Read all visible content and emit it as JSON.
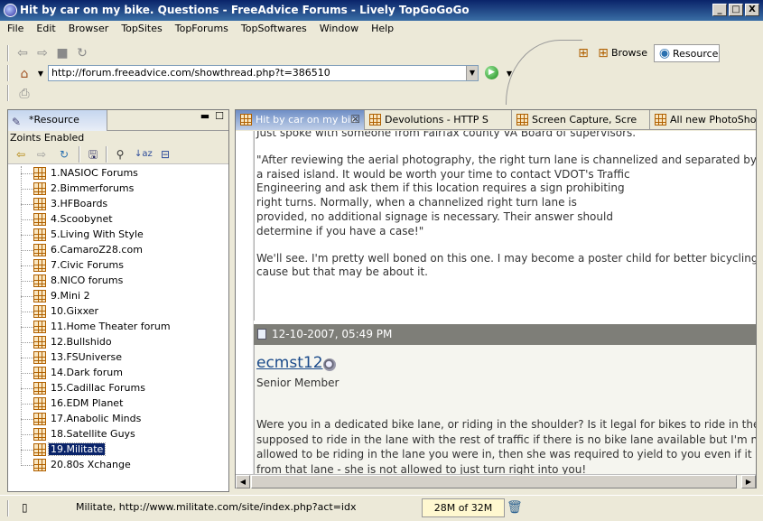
{
  "window": {
    "title": "Hit by car on my bike. Questions - FreeAdvice Forums - Lively TopGoGoGo",
    "buttons": [
      "_",
      "□",
      "X"
    ]
  },
  "menu": [
    "File",
    "Edit",
    "Browser",
    "TopSites",
    "TopForums",
    "TopSoftwares",
    "Window",
    "Help"
  ],
  "address": {
    "url": "http://forum.freeadvice.com/showthread.php?t=386510"
  },
  "perspectives": {
    "browse": "Browse",
    "resource": "Resource"
  },
  "left_panel": {
    "tab_label": "*Resource",
    "status": "Zoints Enabled",
    "tree_items": [
      "1.NASIOC Forums",
      "2.Bimmerforums",
      "3.HFBoards",
      "4.Scoobynet",
      "5.Living With Style",
      "6.CamaroZ28.com",
      "7.Civic Forums",
      "8.NICO forums",
      "9.Mini 2",
      "10.Gixxer",
      "11.Home Theater forum",
      "12.Bullshido",
      "13.FSUniverse",
      "14.Dark forum",
      "15.Cadillac Forums",
      "16.EDM Planet",
      "17.Anabolic Minds",
      "18.Satellite Guys",
      "19.Militate",
      "20.80s Xchange"
    ],
    "selected_index": 18
  },
  "editor": {
    "tabs": [
      "Hit by car on my bik",
      "Devolutions - HTTP S",
      "Screen Capture, Scre",
      "All new PhotoShow"
    ],
    "post1": {
      "top_line": "Just spoke with someone from Fairfax county VA Board of supervisors.",
      "quote_lines": [
        "\"After reviewing the aerial photography, the right turn lane is channelized and separated by",
        "a raised island. It would be worth your time to contact VDOT's Traffic",
        "Engineering and ask them if this location requires a sign prohibiting",
        "right turns. Normally, when a channelized right turn lane is",
        "provided, no additional signage is necessary. Their answer should",
        "determine if you have a case!\""
      ],
      "followup_lines": [
        "We'll see. I'm pretty well boned on this one. I may become a poster child for better bicycling arou",
        "cause but that may be about it."
      ]
    },
    "post2": {
      "date": "12-10-2007, 05:49 PM",
      "username": "ecmst12",
      "user_title": "Senior Member",
      "body_lines": [
        "Were you in a dedicated bike lane, or riding in the shoulder? Is it legal for bikes to ride in the sho",
        "supposed to ride in the lane with the rest of traffic if there is no bike lane available but I'm not su",
        "allowed to be riding in the lane you were in, then she was required to yield to you even if it was",
        "from that lane - she is not allowed to just turn right into you!"
      ]
    }
  },
  "statusbar": {
    "text": "Militate, http://www.militate.com/site/index.php?act=idx",
    "memory": "28M of 32M"
  }
}
